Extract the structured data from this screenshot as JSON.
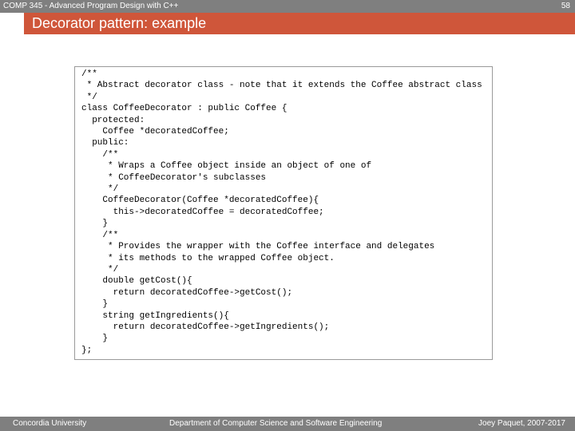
{
  "header": {
    "course": "COMP 345 - Advanced Program Design with C++",
    "page_number": "58"
  },
  "slide": {
    "title": "Decorator pattern: example"
  },
  "code": {
    "lines": [
      "/**",
      " * Abstract decorator class - note that it extends the Coffee abstract class",
      " */",
      "class CoffeeDecorator : public Coffee {",
      "  protected:",
      "    Coffee *decoratedCoffee;",
      "  public:",
      "    /**",
      "     * Wraps a Coffee object inside an object of one of",
      "     * CoffeeDecorator's subclasses",
      "     */",
      "    CoffeeDecorator(Coffee *decoratedCoffee){",
      "      this->decoratedCoffee = decoratedCoffee;",
      "    }",
      "    /**",
      "     * Provides the wrapper with the Coffee interface and delegates",
      "     * its methods to the wrapped Coffee object.",
      "     */",
      "    double getCost(){",
      "      return decoratedCoffee->getCost();",
      "    }",
      "    string getIngredients(){",
      "      return decoratedCoffee->getIngredients();",
      "    }",
      "};"
    ]
  },
  "footer": {
    "left": "Concordia University",
    "center": "Department of Computer Science and Software Engineering",
    "right": "Joey Paquet, 2007-2017"
  }
}
